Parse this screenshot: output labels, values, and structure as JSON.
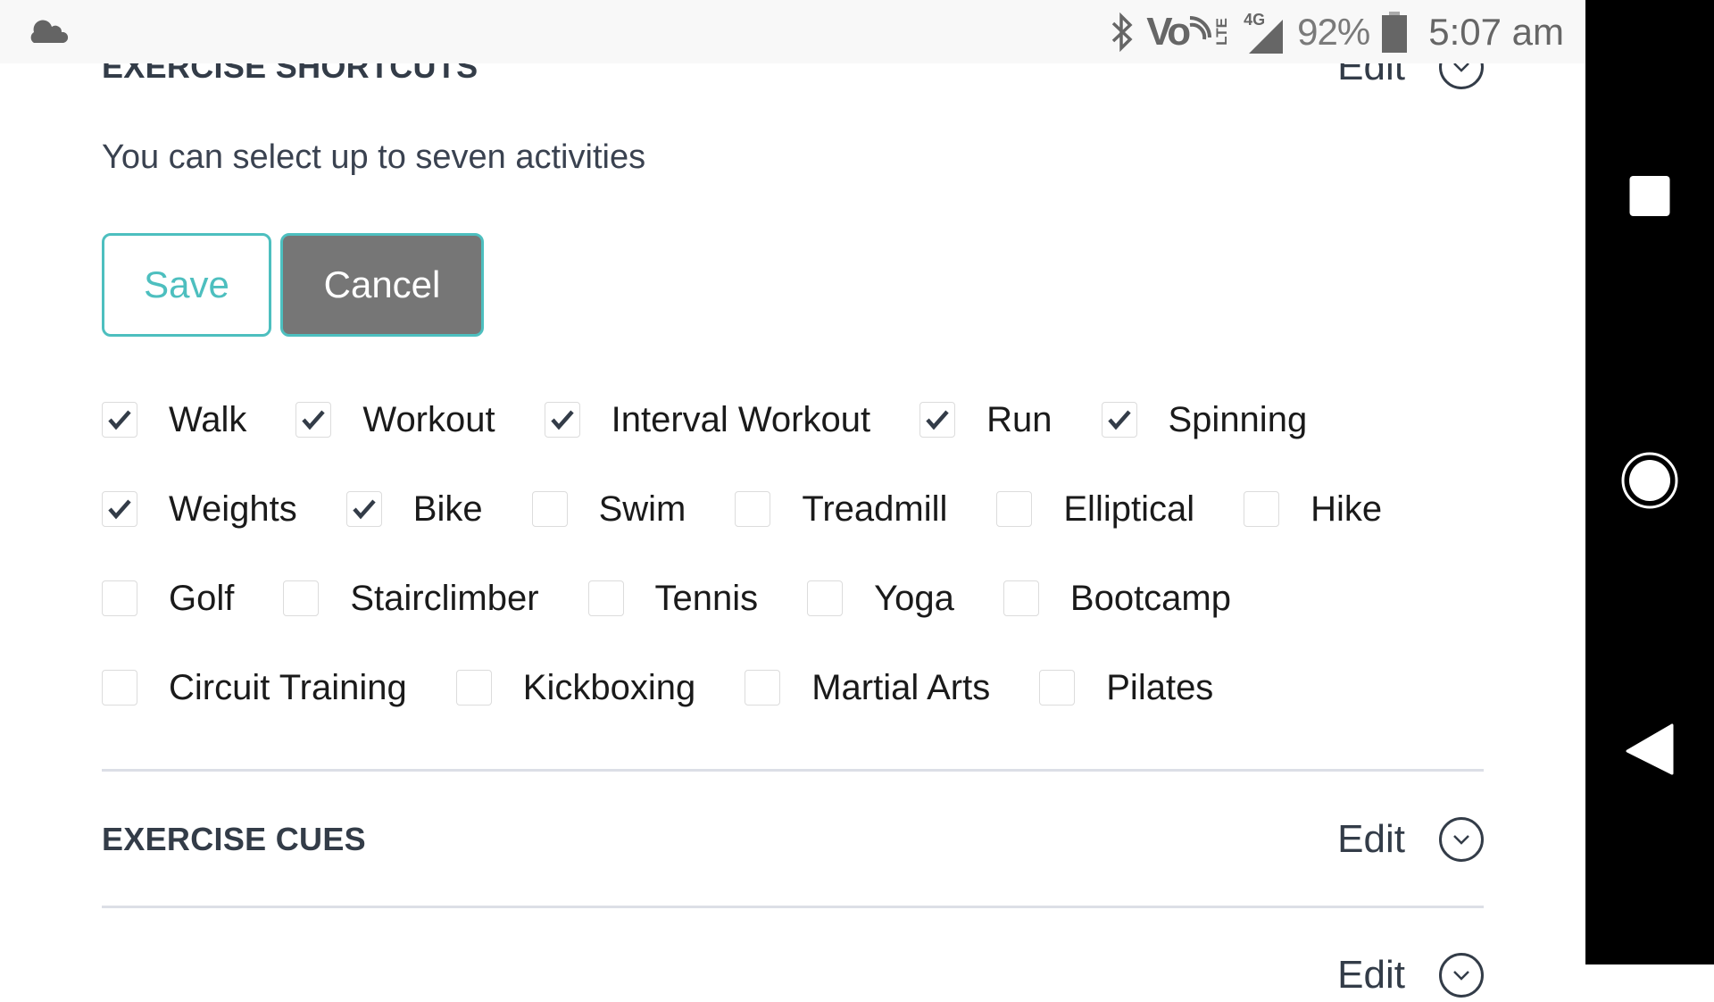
{
  "status_bar": {
    "left_icons": [
      "cloud-icon"
    ],
    "right_icons": [
      "bluetooth-icon",
      "volte-icon",
      "lte-icon",
      "4g-signal-icon",
      "battery-icon"
    ],
    "network_label": "4G",
    "lte_label": "LTE",
    "volte_label": "Vo",
    "battery_percent": "92%",
    "time": "5:07 am"
  },
  "nav_bar": {
    "buttons": [
      "recents",
      "home",
      "back"
    ]
  },
  "sections": {
    "shortcuts": {
      "title": "EXERCISE SHORTCUTS",
      "edit_label": "Edit",
      "description": "You can select up to seven activities",
      "save_label": "Save",
      "cancel_label": "Cancel",
      "rows": [
        [
          {
            "label": "Walk",
            "checked": true
          },
          {
            "label": "Workout",
            "checked": true
          },
          {
            "label": "Interval Workout",
            "checked": true
          },
          {
            "label": "Run",
            "checked": true
          },
          {
            "label": "Spinning",
            "checked": true
          }
        ],
        [
          {
            "label": "Weights",
            "checked": true
          },
          {
            "label": "Bike",
            "checked": true
          },
          {
            "label": "Swim",
            "checked": false
          },
          {
            "label": "Treadmill",
            "checked": false
          },
          {
            "label": "Elliptical",
            "checked": false
          },
          {
            "label": "Hike",
            "checked": false
          }
        ],
        [
          {
            "label": "Golf",
            "checked": false
          },
          {
            "label": "Stairclimber",
            "checked": false
          },
          {
            "label": "Tennis",
            "checked": false
          },
          {
            "label": "Yoga",
            "checked": false
          },
          {
            "label": "Bootcamp",
            "checked": false
          }
        ],
        [
          {
            "label": "Circuit Training",
            "checked": false
          },
          {
            "label": "Kickboxing",
            "checked": false
          },
          {
            "label": "Martial Arts",
            "checked": false
          },
          {
            "label": "Pilates",
            "checked": false
          }
        ]
      ]
    },
    "cues": {
      "title": "EXERCISE CUES",
      "edit_label": "Edit"
    },
    "next": {
      "edit_label": "Edit"
    }
  },
  "colors": {
    "accent": "#4dbfbf",
    "cancel_bg": "#767676",
    "text_dark": "#333c48",
    "status_bg": "#f8f8f8",
    "divider": "#dcdfe6"
  }
}
